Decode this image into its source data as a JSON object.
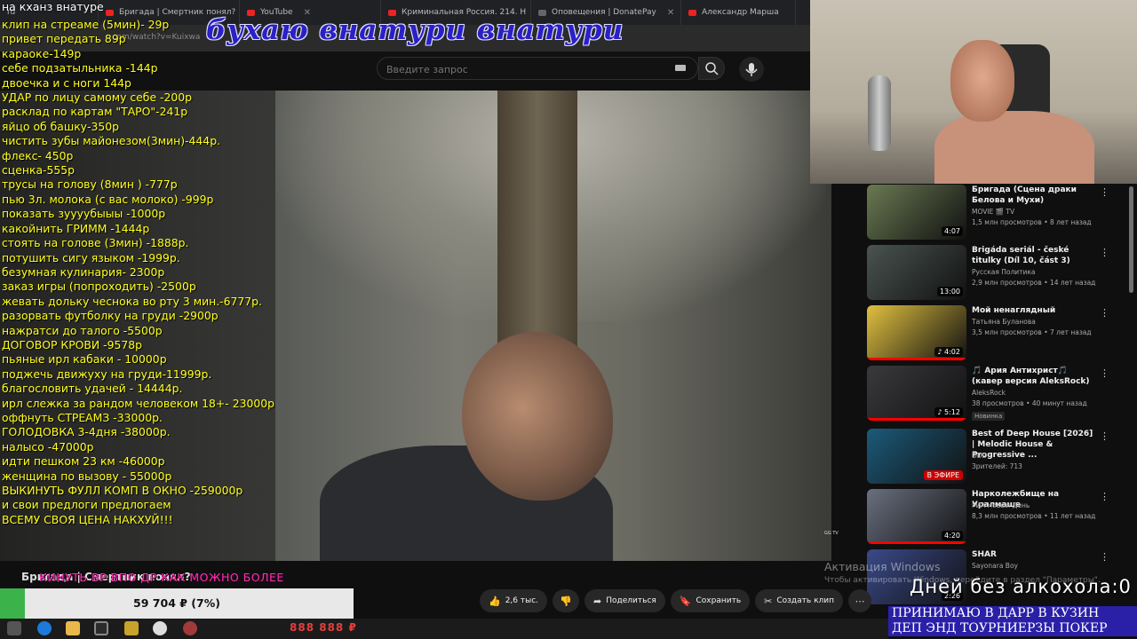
{
  "browser": {
    "tabs": [
      {
        "label": "rd"
      },
      {
        "label": "Бригада | Смертник понял?"
      },
      {
        "label": "YouTube"
      },
      {
        "label": "Криминальная Россия. 214. Н"
      },
      {
        "label": "Оповещения | DonatePay"
      },
      {
        "label": "Александр Марша"
      }
    ],
    "url": "...com/watch?v=Kuixwa"
  },
  "youtube": {
    "search_placeholder": "Введите запрос",
    "video_watermark": "GG TV",
    "video_title": "Бригада | Смертник понял?",
    "actions": {
      "like_count": "2,6 тыс.",
      "share": "Поделиться",
      "save": "Сохранить",
      "clip": "Создать клип"
    },
    "recommendations": [
      {
        "title": "Бригада (Сцена драки Белова и Мухи)",
        "channel": "MOVIE 🎬 TV",
        "meta": "1,5 млн просмотров • 8 лет назад",
        "duration": "4:07",
        "color": "#6a7a52"
      },
      {
        "title": "Brigáda seriál - české titulky (Díl 10, část 3)",
        "channel": "Русская Политика",
        "meta": "2,9 млн просмотров • 14 лет назад",
        "duration": "13:00",
        "color": "#4a5450"
      },
      {
        "title": "Мой ненаглядный",
        "channel": "Татьяна Буланова",
        "meta": "3,5 млн просмотров • 7 лет назад",
        "duration": "♪ 4:02",
        "color": "#e0c040"
      },
      {
        "title": "🎵 Ария Антихрист🎵 (кавер версия AleksRock)",
        "channel": "AleksRock",
        "meta": "38 просмотров • 40 минут назад",
        "duration": "♪ 5:12",
        "badge": "Новинка",
        "color": "#3a3a3e"
      },
      {
        "title": "Best of Deep House [2026] | Melodic House & Progressive ...",
        "channel": "DDD.",
        "meta": "Зрителей: 713",
        "duration": "В ЭФИРЕ",
        "color": "#1c5a7a"
      },
      {
        "title": "Нарколежбище на Уралмаше",
        "channel": "РИА Новый День",
        "meta": "8,3 млн просмотров • 11 лет назад",
        "duration": "4:20",
        "color": "#6a7080"
      },
      {
        "title": "SHAR",
        "channel": "Sayonara Boy",
        "meta": "",
        "duration": "2:26",
        "color": "#3a4a8a"
      }
    ]
  },
  "overlay": {
    "title": "на кханз внатуре",
    "banner": "бухаю внатури внатури",
    "donations": [
      "клип на стреаме (5мин)- 29р",
      "привет передать 89р",
      "караоке-149р",
      "себе подзатыльника -144р",
      "двоечка и с ноги 144р",
      "УДАР по лицу самому себе -200р",
      "расклад по картам \"ТАРО\"-241р",
      "яйцо об башку-350р",
      "чистить зубы майонезом(3мин)-444р.",
      "флекс- 450р",
      "сценка-555р",
      "трусы на голову (8мин ) -777р",
      "пью 3л. молока (с вас молоко) -999р",
      "показать зуууубыыы -1000р",
      "какойнить ГРИММ -1444р",
      "стоять на голове (3мин) -1888р.",
      "потушить сигу языком -1999р.",
      "безумная кулинария- 2300р",
      "заказ игры (попроходить) -2500р",
      "жевать дольку чеснока во рту 3 мин.-6777р.",
      "разорвать футболку на груди -2900р",
      "нажратси до талого -5500р",
      "ДОГОВОР КРОВИ -9578р",
      "пьяные ирл кабаки - 10000р",
      "подж​ечь движуху на груди-11999р.",
      "благословить удачей - 14444р.",
      "ирл слежка за рандом человеком 18+- 23000р",
      "оффнуть СТРЕАМЗ -33000р.",
      "ГОЛОДОВКА 3-4дня -38000р.",
      "налысо -47000р",
      "идти пешком 23 км -46000р",
      "женщина по вызову - 55000р",
      "ВЫКИНУТЬ ФУЛЛ КОМП В ОКНО -259000р",
      "и свои предлоги предлогаем",
      "ВСЕМУ СВОЯ ЦЕНА НАКХУЙ!!!"
    ],
    "scroller_text": "КИНУТЬ ВР ВПО ДР КАК МОЖНО БОЛЕЕ",
    "goal": {
      "text": "59 704 ₽ (7%)",
      "progress": 0.07
    },
    "money": "888 888 ₽",
    "win_activation": "Активация Windows",
    "win_activation_sub": "Чтобы активировать Windows, перейдите в раздел \"Параметры\".",
    "days_sober": "Дней без алкохола:0",
    "promo_line1": "ПРИНИМАЮ В ДАРР В КУЗИН",
    "promo_line2": "ДЕП ЭНД ТОУРНИЕРЗЫ ПОКЕР"
  }
}
